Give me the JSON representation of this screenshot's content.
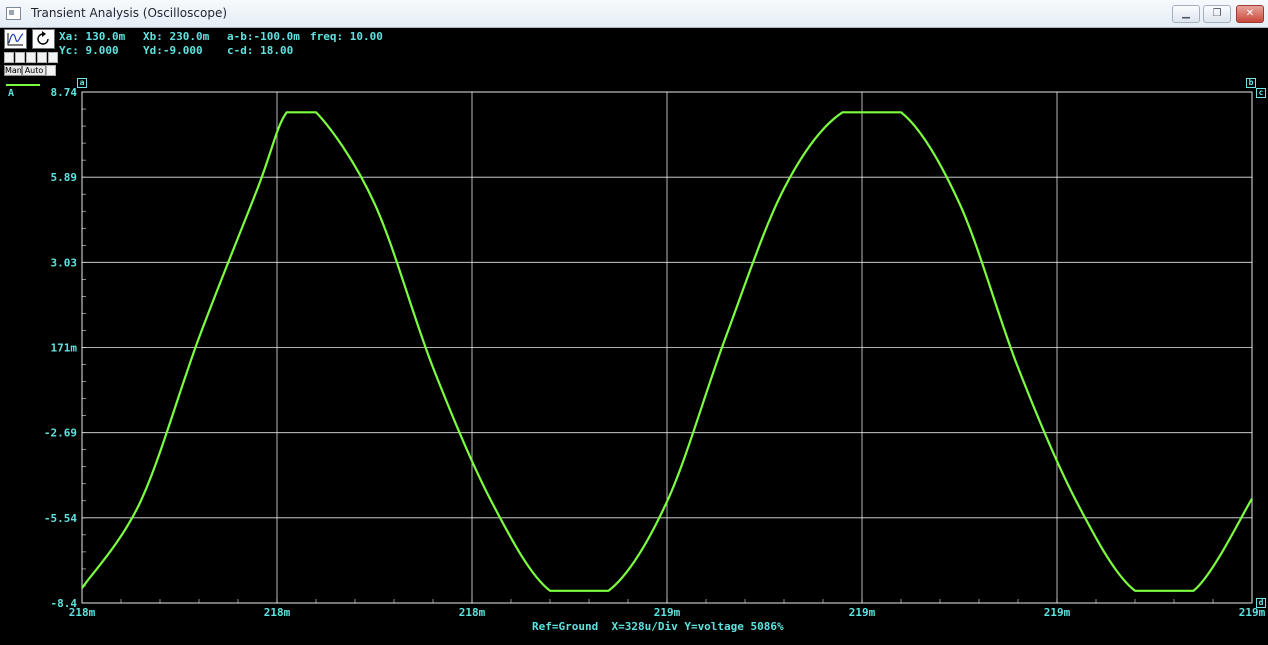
{
  "window": {
    "title": "Transient Analysis (Oscilloscope)",
    "buttons": {
      "minimize": "▁",
      "restore": "❐",
      "close": "✕"
    }
  },
  "toolbar": {
    "man_label": "Man",
    "auto_label": "Auto"
  },
  "cursors": {
    "xa": "Xa: 130.0m",
    "xb": "Xb: 230.0m",
    "ab": "a-b:-100.0m",
    "freq": "freq: 10.00",
    "yc": "Yc: 9.000",
    "yd": "Yd:-9.000",
    "cd": "c-d: 18.00",
    "markers": {
      "a": "a",
      "b": "b",
      "c": "c",
      "d": "d"
    }
  },
  "trace_label": "A",
  "footer": "Ref=Ground  X=328u/Div Y=voltage 5086%",
  "colors": {
    "trace": "#7cff3f",
    "grid": "#e8e8e8",
    "text": "#5fe3e0",
    "background": "#000000"
  },
  "chart_data": {
    "type": "line",
    "y_ticks": [
      "8.74",
      "5.89",
      "3.03",
      "171m",
      "-2.69",
      "-5.54",
      "-8.4"
    ],
    "x_ticks": [
      "218m",
      "218m",
      "218m",
      "219m",
      "219m",
      "219m",
      "219m"
    ],
    "ylim": [
      -8.4,
      8.74
    ],
    "x_units_per_div": "328u",
    "series": [
      {
        "name": "A",
        "clip_high": 8.06,
        "clip_low": -7.99,
        "x": [
          218.0,
          218.1,
          218.2,
          218.3,
          218.35,
          218.4,
          218.5,
          218.6,
          218.7,
          218.8,
          218.9,
          219.0,
          219.1,
          219.2,
          219.3,
          219.4,
          219.5,
          219.6,
          219.7,
          219.8,
          219.9,
          220.0
        ],
        "values": [
          -7.9,
          -5.0,
          0.5,
          5.5,
          8.06,
          8.06,
          5.0,
          -0.5,
          -5.0,
          -7.99,
          -7.99,
          -5.0,
          0.5,
          5.5,
          8.06,
          8.06,
          5.0,
          -0.5,
          -5.0,
          -7.99,
          -7.99,
          -4.9
        ]
      }
    ]
  }
}
